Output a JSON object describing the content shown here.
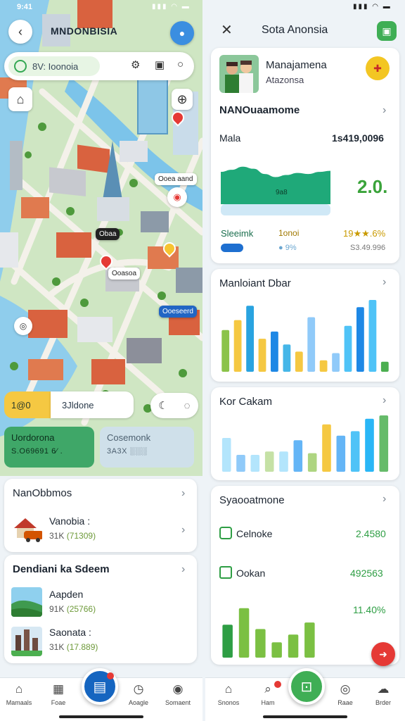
{
  "left": {
    "status": {
      "time": "9:41",
      "icons": "▮▮▮ ◠ ▬"
    },
    "map": {
      "title": "MNDONBISIA",
      "search_badge": "8V: Ioonoia",
      "labels": [
        "Ooea aand",
        "Ooasoa",
        "Obaa",
        "Ooeseerd"
      ]
    },
    "chips": {
      "a": "1@0",
      "b": "3Jldone"
    },
    "promos": [
      {
        "title": "Uordorona",
        "sub": "S.O69691   6⁄ ."
      },
      {
        "title": "Cosemonk",
        "sub": "3A3X  ░░░"
      }
    ],
    "card1": {
      "title": "NanObbmos",
      "items": [
        {
          "title": "Vanobia :",
          "sub_a": "31K",
          "sub_b": "(71309)"
        }
      ]
    },
    "card2": {
      "title": "Dendiani ka Sdeem",
      "items": [
        {
          "title": "Aapden",
          "sub_a": "91K",
          "sub_b": "(25766)"
        },
        {
          "title": "Saonata :",
          "sub_a": "31K",
          "sub_b": "(17.889)"
        }
      ]
    },
    "nav": [
      {
        "label": "Mamaals",
        "icon": "⌂"
      },
      {
        "label": "Foae",
        "icon": "▦"
      },
      {
        "label": "",
        "icon": "▤"
      },
      {
        "label": "Aoagle",
        "icon": "◷"
      },
      {
        "label": "Somaent",
        "icon": "◉"
      }
    ]
  },
  "right": {
    "status": {
      "icons": "▮▮▮ ◠ ▬"
    },
    "header": {
      "title": "Sota Anonsia"
    },
    "profile": {
      "name": "Manajamena",
      "sub": "Atazonsa"
    },
    "overview": {
      "title": "NANOuaamome",
      "metric_label": "Mala",
      "metric_value": "1s419,0096",
      "chart_label": "9a8",
      "big_value": "2.0.",
      "row_a": "Sleeimk",
      "row_b": "1onoi",
      "row_c": "19★★.6%",
      "row_d": "● 9%",
      "row_e": "S3.49.996"
    },
    "card_bars1": {
      "title": "Manloiant Dbar"
    },
    "card_bars2": {
      "title": "Kor Cakam"
    },
    "card_stats": {
      "title": "Syaooatmone",
      "rows": [
        {
          "label": "Celnoke",
          "value": "2.4580"
        },
        {
          "label": "Ookan",
          "value": "492563"
        }
      ],
      "pct": "11.40%"
    },
    "nav": [
      {
        "label": "Snonos",
        "icon": "⌂"
      },
      {
        "label": "Ham",
        "icon": "⌕"
      },
      {
        "label": "",
        "icon": "⊡"
      },
      {
        "label": "Raae",
        "icon": "◎"
      },
      {
        "label": "Brder",
        "icon": "☁"
      }
    ]
  },
  "chart_data": [
    {
      "type": "area",
      "title": "",
      "x": [
        0,
        1,
        2,
        3,
        4,
        5,
        6,
        7,
        8,
        9,
        10
      ],
      "series": [
        {
          "values": [
            62,
            66,
            72,
            68,
            58,
            52,
            56,
            60,
            58,
            62,
            64
          ]
        }
      ],
      "color": "#1fa979"
    },
    {
      "type": "bar",
      "title": "Manloiant Dbar",
      "categories": [
        "1",
        "2",
        "3",
        "4",
        "5",
        "6",
        "7",
        "8",
        "9",
        "10",
        "11",
        "12",
        "13",
        "14"
      ],
      "values": [
        58,
        72,
        92,
        46,
        56,
        38,
        28,
        76,
        16,
        26,
        64,
        90,
        100,
        14
      ],
      "colors": [
        "#8bc34a",
        "#f5c842",
        "#29a3e0",
        "#f5c842",
        "#1e88e5",
        "#45b6e8",
        "#f5c842",
        "#90caf9",
        "#f5c842",
        "#90caf9",
        "#4fc3f7",
        "#1e88e5",
        "#4fc3f7",
        "#4caf50"
      ],
      "ylim": [
        0,
        100
      ]
    },
    {
      "type": "bar",
      "title": "Kor Cakam",
      "categories": [
        "1",
        "2",
        "3",
        "4",
        "5",
        "6",
        "7",
        "8",
        "9",
        "10",
        "11",
        "12"
      ],
      "values": [
        60,
        30,
        30,
        36,
        36,
        56,
        33,
        84,
        64,
        72,
        94,
        100
      ],
      "colors": [
        "#b3e5fc",
        "#90caf9",
        "#b3e5fc",
        "#c5e1a5",
        "#b3e5fc",
        "#64b5f6",
        "#aed581",
        "#f5c842",
        "#64b5f6",
        "#4fc3f7",
        "#29b6f6",
        "#66bb6a"
      ],
      "ylim": [
        0,
        100
      ]
    },
    {
      "type": "bar",
      "title": "",
      "categories": [
        "1",
        "2",
        "3",
        "4",
        "5",
        "6"
      ],
      "values": [
        60,
        90,
        52,
        28,
        42,
        64
      ],
      "colors": [
        "#2e9e44",
        "#7bc043",
        "#7bc043",
        "#7bc043",
        "#7bc043",
        "#7bc043"
      ],
      "ylim": [
        0,
        100
      ]
    }
  ]
}
